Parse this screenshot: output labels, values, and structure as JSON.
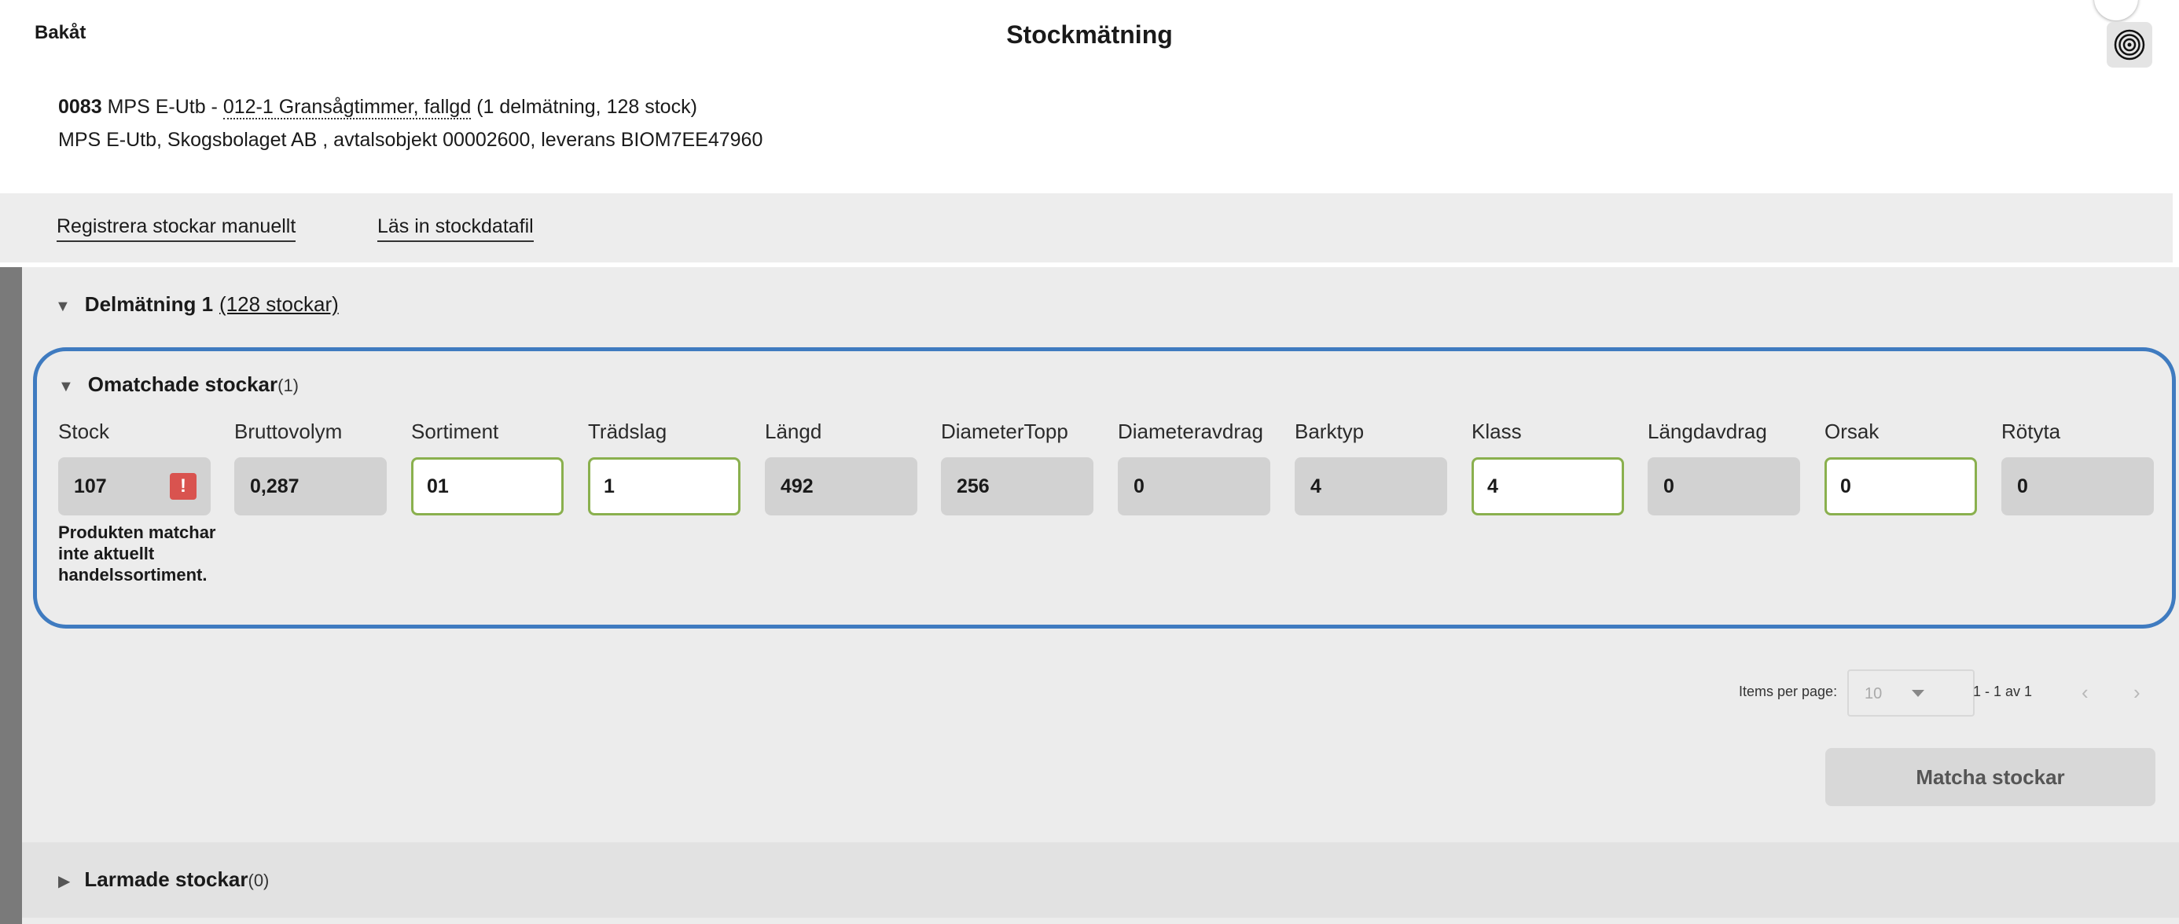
{
  "header": {
    "back_label": "Bakåt",
    "title": "Stockmätning",
    "info_code": "0083",
    "info_prefix": " MPS E-Utb - ",
    "info_assortment": "012-1 Gransågtimmer, fallgd",
    "info_suffix": " (1 delmätning, 128 stock)",
    "info_line2": "MPS E-Utb, Skogsbolaget AB , avtalsobjekt 00002600, leverans BIOM7EE47960"
  },
  "actions": {
    "register_manual": "Registrera stockar manuellt",
    "read_file": "Läs in stockdatafil"
  },
  "delmatning": {
    "title": "Delmätning 1",
    "count": "(128 stockar)"
  },
  "unmatched": {
    "title": "Omatchade stockar",
    "count": "(1)",
    "columns": [
      "Stock",
      "Bruttovolym",
      "Sortiment",
      "Trädslag",
      "Längd",
      "DiameterTopp",
      "Diameteravdrag",
      "Barktyp",
      "Klass",
      "Längdavdrag",
      "Orsak",
      "Rötyta"
    ],
    "values": [
      "107",
      "0,287",
      "01",
      "1",
      "492",
      "256",
      "0",
      "4",
      "4",
      "0",
      "0",
      "0"
    ],
    "error_message": "Produkten matchar inte aktuellt handelssortiment."
  },
  "pagination": {
    "items_per_page_label": "Items per page:",
    "items_per_page_value": "10",
    "range": "1 - 1 av 1"
  },
  "match_button": "Matcha stockar",
  "alarmed": {
    "title": "Larmade stockar",
    "count": "(0)"
  },
  "colors": {
    "panel_border": "#3f7bc0",
    "editable_border": "#8ab04e",
    "error": "#d9534f"
  }
}
